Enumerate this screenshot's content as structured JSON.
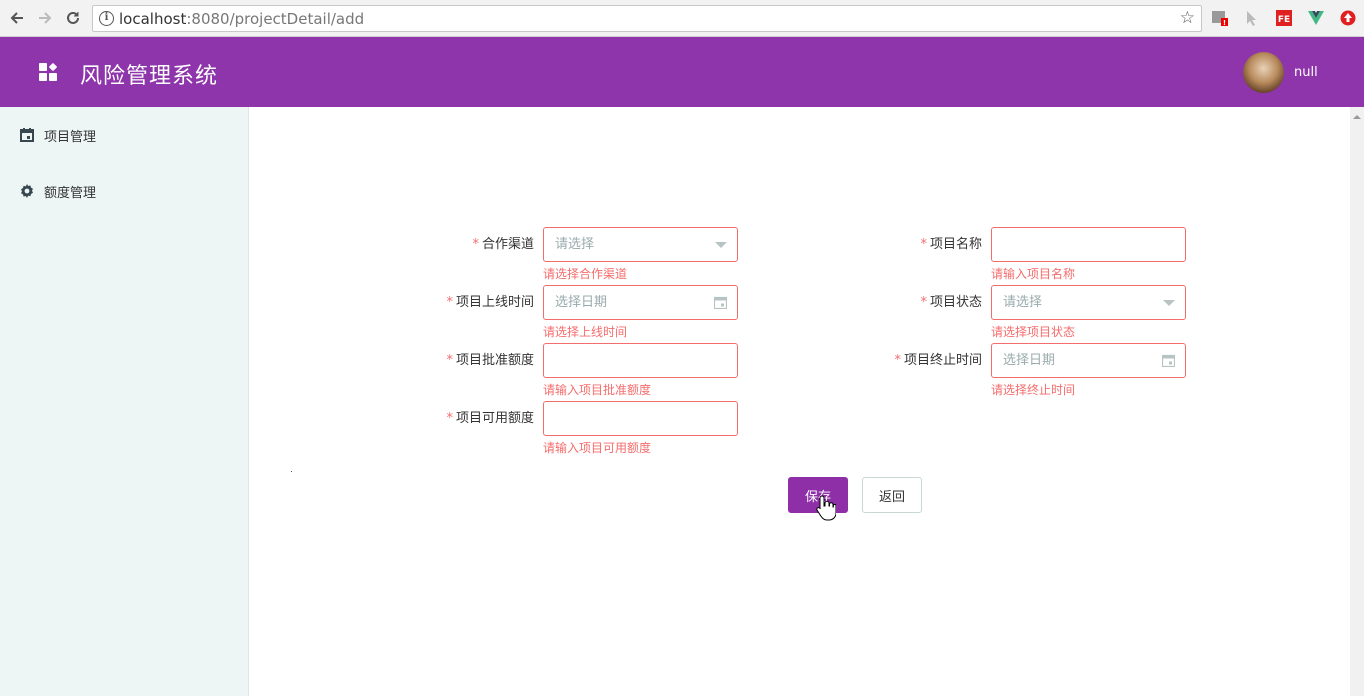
{
  "browser": {
    "url_host": "localhost",
    "url_rest": ":8080/projectDetail/add",
    "extensions": [
      "puzzle-icon",
      "cursor-icon",
      "fe-icon",
      "vue-icon",
      "upload-icon"
    ]
  },
  "header": {
    "title": "风险管理系统",
    "username": "null"
  },
  "sidebar": {
    "items": [
      {
        "label": "项目管理",
        "icon": "calendar-icon"
      },
      {
        "label": "额度管理",
        "icon": "gear-icon"
      }
    ]
  },
  "form": {
    "channel": {
      "label": "合作渠道",
      "placeholder": "请选择",
      "error": "请选择合作渠道"
    },
    "project_name": {
      "label": "项目名称",
      "value": "",
      "error": "请输入项目名称"
    },
    "online_time": {
      "label": "项目上线时间",
      "placeholder": "选择日期",
      "error": "请选择上线时间"
    },
    "status": {
      "label": "项目状态",
      "placeholder": "请选择",
      "error": "请选择项目状态"
    },
    "approved_amount": {
      "label": "项目批准额度",
      "value": "",
      "error": "请输入项目批准额度"
    },
    "end_time": {
      "label": "项目终止时间",
      "placeholder": "选择日期",
      "error": "请选择终止时间"
    },
    "available_amount": {
      "label": "项目可用额度",
      "value": "",
      "error": "请输入项目可用额度"
    },
    "required_mark": "*"
  },
  "actions": {
    "save_label": "保存",
    "back_label": "返回"
  },
  "colors": {
    "brand": "#8e35ab",
    "error": "#f56c6c",
    "sidebar_bg": "#eef6f5"
  }
}
